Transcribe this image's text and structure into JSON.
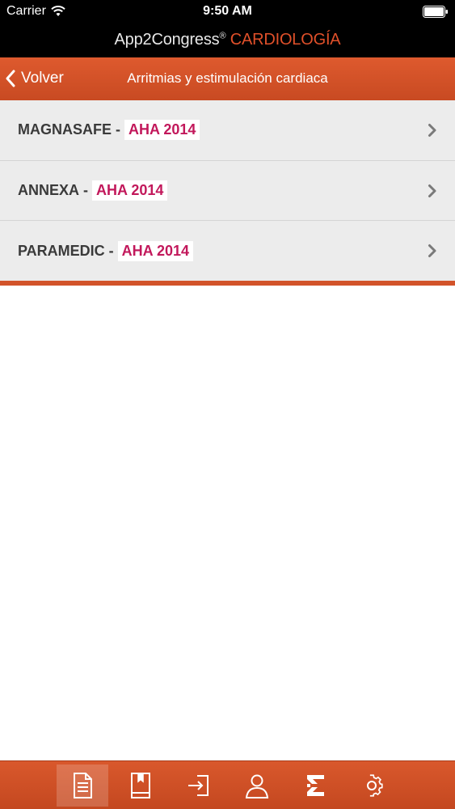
{
  "status_bar": {
    "carrier": "Carrier",
    "time": "9:50 AM"
  },
  "brand": {
    "name": "App2Congress",
    "reg": "®",
    "accent": "CARDIOLOGÍA"
  },
  "nav": {
    "back_label": "Volver",
    "title": "Arritmias y estimulación cardiaca"
  },
  "items": [
    {
      "name": "MAGNASAFE",
      "sep": "-",
      "tag": "AHA 2014"
    },
    {
      "name": "ANNEXA",
      "sep": "-",
      "tag": "AHA 2014"
    },
    {
      "name": "PARAMEDIC",
      "sep": "-",
      "tag": "AHA 2014"
    }
  ],
  "tabs": [
    {
      "icon": "document-icon",
      "active": true
    },
    {
      "icon": "book-icon",
      "active": false
    },
    {
      "icon": "login-icon",
      "active": false
    },
    {
      "icon": "user-icon",
      "active": false
    },
    {
      "icon": "logo-e-icon",
      "active": false
    },
    {
      "icon": "gear-icon",
      "active": false
    }
  ],
  "colors": {
    "accent": "#d2532a",
    "tag": "#c2185b",
    "list_bg": "#ececec"
  }
}
